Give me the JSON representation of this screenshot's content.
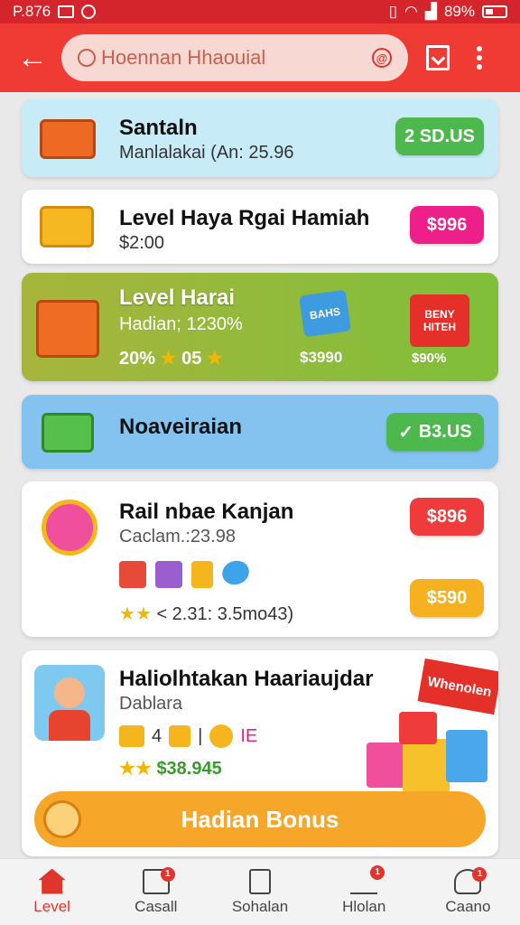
{
  "status": {
    "time": "P.876",
    "battery": "89%"
  },
  "search": {
    "text": "Hoennan Hhaouial",
    "alert": "@"
  },
  "cards": [
    {
      "title": "Santaln",
      "subtitle": "Manlalakai (An: 25.96",
      "button": "2 SD.US"
    },
    {
      "title": "Level Haya Rgai Hamiah",
      "subtitle": "$2:00",
      "button": "$996"
    },
    {
      "title": "Level Harai",
      "subtitle": "Hadian; 1230%",
      "stats": "20%",
      "stats_extra": "05",
      "tag1": "BAHS",
      "tag1_price": "$3990",
      "tag2": "BENY HITEH",
      "tag2_price": "$90%"
    },
    {
      "title": "Noaveiraian",
      "button": "B3.US"
    },
    {
      "title": "Rail nbae Kanjan",
      "subtitle": "Caclam.:23.98",
      "button1": "$896",
      "button2": "$590",
      "rating": "< 2.31: 3.5mo43)"
    },
    {
      "title": "Haliolhtakan Haariaujdar",
      "subtitle": "Dablara",
      "items_text": "4",
      "items_value": "IE",
      "price": "$38.945",
      "ribbon": "Whenolen",
      "cta": "Hadian Bonus"
    }
  ],
  "nav": [
    {
      "label": "Level",
      "active": true
    },
    {
      "label": "Casall",
      "badge": "1"
    },
    {
      "label": "Sohalan"
    },
    {
      "label": "Hlolan",
      "badge": "1"
    },
    {
      "label": "Caano",
      "badge": "1"
    }
  ],
  "colors": {
    "primary": "#ef3b33",
    "green": "#4db84e",
    "pink": "#ef1f8a",
    "orange": "#f6a72a"
  }
}
